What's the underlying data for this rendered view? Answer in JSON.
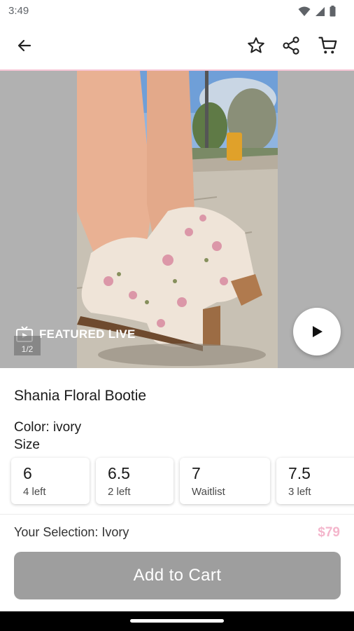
{
  "status_bar": {
    "time": "3:49"
  },
  "media": {
    "featured_label": "FEATURED LIVE",
    "pager": "1/2"
  },
  "product": {
    "title": "Shania Floral Bootie",
    "color_label": "Color: ivory",
    "size_label": "Size",
    "sizes": [
      {
        "size": "6",
        "availability": "4 left"
      },
      {
        "size": "6.5",
        "availability": "2 left"
      },
      {
        "size": "7",
        "availability": "Waitlist"
      },
      {
        "size": "7.5",
        "availability": "3 left"
      }
    ],
    "selection": "Your Selection: Ivory",
    "price": "$79",
    "add_to_cart": "Add to Cart"
  },
  "colors": {
    "accent_pink": "#f7c6d6",
    "price_pink": "#f4b6cc",
    "cta_disabled": "#9e9e9e"
  }
}
